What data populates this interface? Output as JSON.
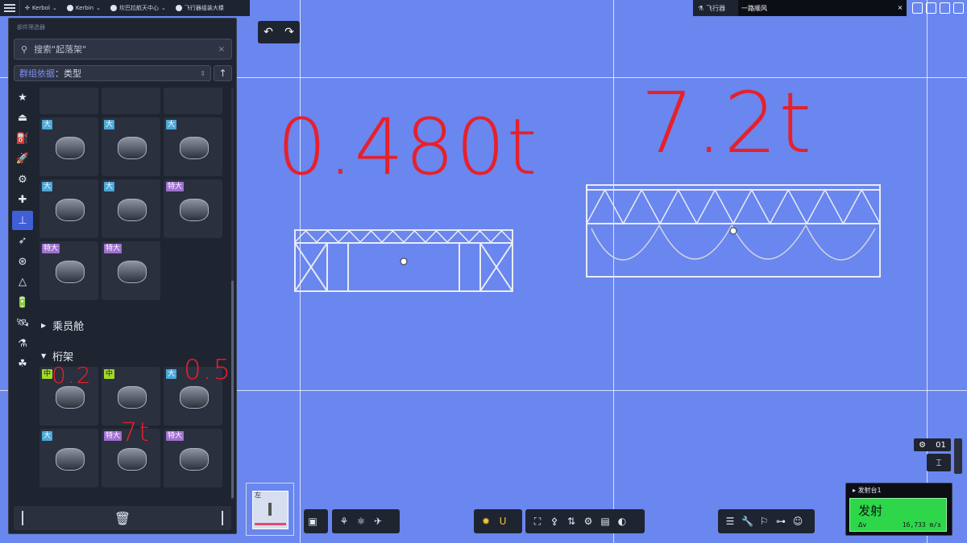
{
  "topbar": {
    "crumbs": [
      {
        "label": "Kerbol"
      },
      {
        "label": "Kerbin"
      },
      {
        "label": "坎巴拉航天中心"
      },
      {
        "label": "飞行器组装大楼"
      }
    ]
  },
  "vessel": {
    "label": "飞行器",
    "name": "一路顺风",
    "close": "×"
  },
  "panel": {
    "title": "部件筛选器",
    "search_placeholder": "搜索\"起落架\"",
    "clear": "×",
    "group_key": "群组依据",
    "group_sep": "：",
    "group_value": "类型",
    "sort": "↑",
    "categories": [
      {
        "icon": "star-icon",
        "glyph": "★"
      },
      {
        "icon": "pod-icon",
        "glyph": "⏏"
      },
      {
        "icon": "fuel-tank-icon",
        "glyph": "⛽"
      },
      {
        "icon": "engine-icon",
        "glyph": "🚀"
      },
      {
        "icon": "control-icon",
        "glyph": "⚙"
      },
      {
        "icon": "structural-icon",
        "glyph": "✚"
      },
      {
        "icon": "coupling-icon",
        "glyph": "⊥"
      },
      {
        "icon": "aero-icon",
        "glyph": "➶"
      },
      {
        "icon": "ground-icon",
        "glyph": "⊛"
      },
      {
        "icon": "thermal-icon",
        "glyph": "△"
      },
      {
        "icon": "electrical-icon",
        "glyph": "🔋"
      },
      {
        "icon": "communication-icon",
        "glyph": "🛰"
      },
      {
        "icon": "science-icon",
        "glyph": "⚗"
      },
      {
        "icon": "cargo-icon",
        "glyph": "☘"
      }
    ],
    "tiles_top": [
      {
        "badge": "大",
        "size": "big"
      },
      {
        "badge": "大",
        "size": "big"
      },
      {
        "badge": "大",
        "size": "big"
      },
      {
        "badge": "大",
        "size": "big"
      },
      {
        "badge": "大",
        "size": "big"
      },
      {
        "badge": "特大",
        "size": "xl"
      },
      {
        "badge": "特大",
        "size": "xl"
      },
      {
        "badge": "特大",
        "size": "xl"
      }
    ],
    "section_crew": "乘员舱",
    "section_truss": "桁架",
    "tiles_truss": [
      {
        "badge": "中",
        "size": "mid"
      },
      {
        "badge": "中",
        "size": "mid"
      },
      {
        "badge": "大",
        "size": "big"
      },
      {
        "badge": "大",
        "size": "big"
      },
      {
        "badge": "特大",
        "size": "xl"
      },
      {
        "badge": "特大",
        "size": "xl"
      }
    ]
  },
  "annotations": {
    "mass_small": "0.480t",
    "mass_large": "7.2t",
    "note_02": "0.2",
    "note_05": "0.5",
    "note_7t": "7t"
  },
  "symmetry": {
    "label": "左"
  },
  "stage": {
    "number": "01"
  },
  "launch": {
    "site": "发射台1",
    "button": "发射",
    "dv_label": "Δv",
    "speed": "16,733 m/s"
  },
  "colors": {
    "background": "#6a86ef",
    "launch_green": "#2ed64a",
    "badge_big": "#4aa8d8",
    "badge_xl": "#a070d0",
    "badge_mid": "#a3d92a",
    "annotation_red": "#e8202a"
  }
}
